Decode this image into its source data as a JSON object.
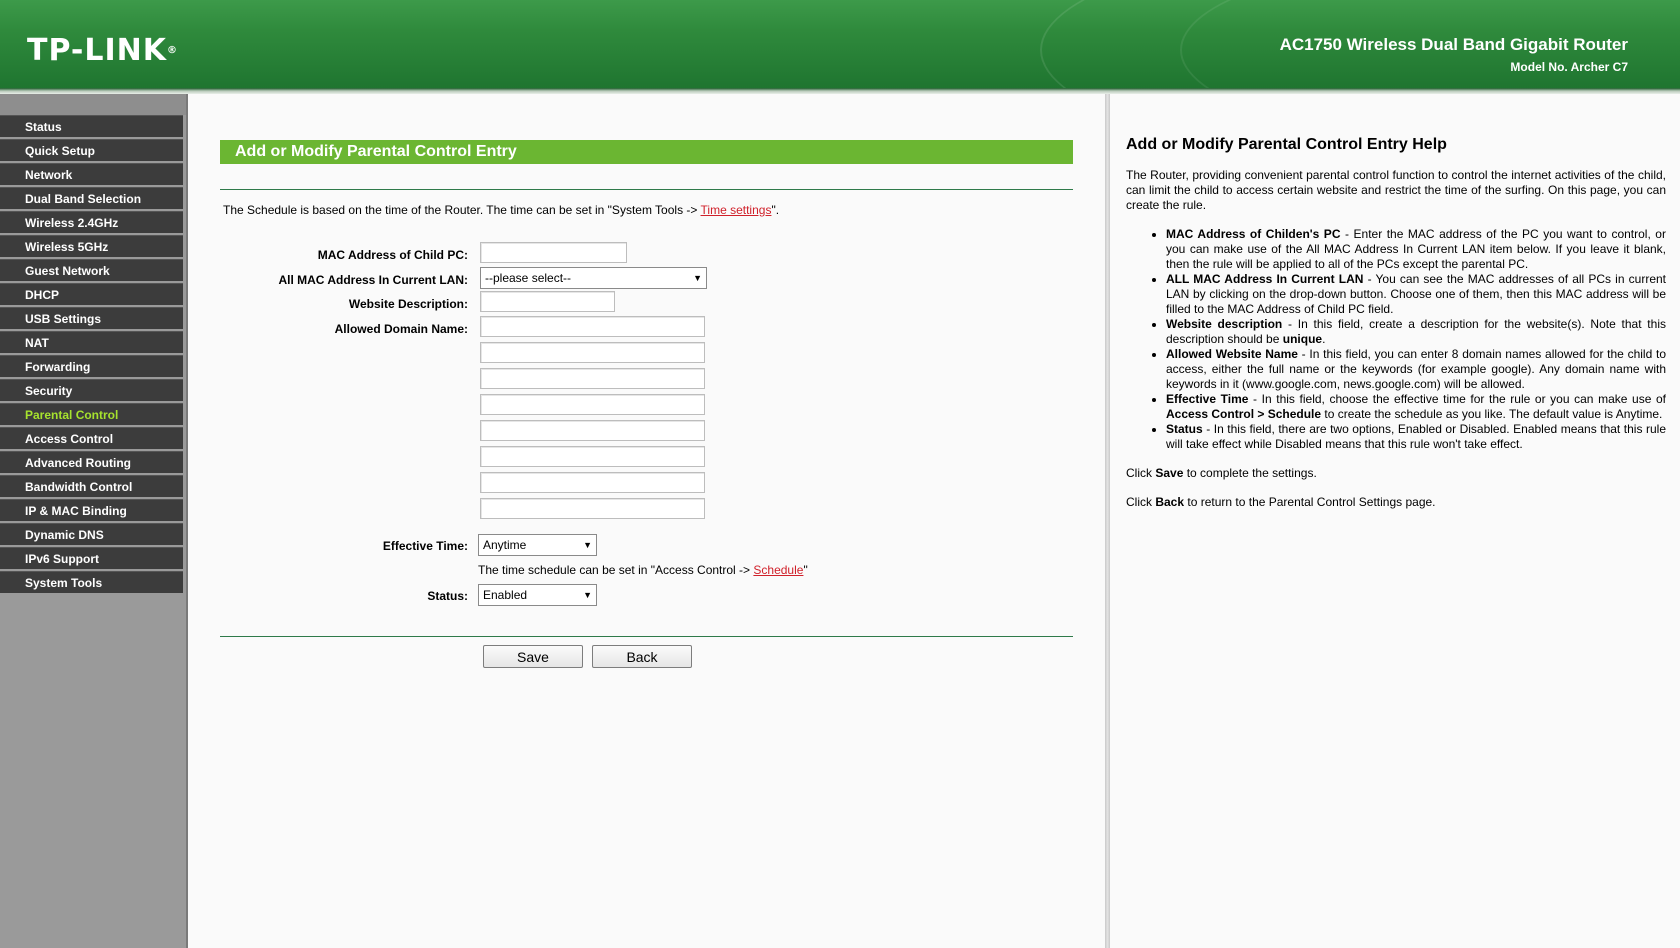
{
  "header": {
    "logo": "TP-LINK",
    "logo_mark": "®",
    "product_name": "AC1750 Wireless Dual Band Gigabit Router",
    "model": "Model No. Archer C7"
  },
  "sidebar": {
    "items": [
      {
        "label": "Status"
      },
      {
        "label": "Quick Setup"
      },
      {
        "label": "Network"
      },
      {
        "label": "Dual Band Selection"
      },
      {
        "label": "Wireless 2.4GHz"
      },
      {
        "label": "Wireless 5GHz"
      },
      {
        "label": "Guest Network"
      },
      {
        "label": "DHCP"
      },
      {
        "label": "USB Settings"
      },
      {
        "label": "NAT"
      },
      {
        "label": "Forwarding"
      },
      {
        "label": "Security"
      },
      {
        "label": "Parental Control"
      },
      {
        "label": "Access Control"
      },
      {
        "label": "Advanced Routing"
      },
      {
        "label": "Bandwidth Control"
      },
      {
        "label": "IP & MAC Binding"
      },
      {
        "label": "Dynamic DNS"
      },
      {
        "label": "IPv6 Support"
      },
      {
        "label": "System Tools"
      }
    ],
    "active_index": 12
  },
  "main": {
    "title": "Add or Modify Parental Control Entry",
    "schedule_note_pre": "The Schedule is based on the time of the Router. The time can be set in \"System Tools -> ",
    "schedule_note_link": "Time settings",
    "schedule_note_post": "\".",
    "fields": {
      "mac_label": "MAC Address of Child PC:",
      "mac_value": "",
      "all_mac_label": "All MAC Address In Current LAN:",
      "all_mac_selected": "--please select--",
      "website_desc_label": "Website Description:",
      "website_desc_value": "",
      "domain_label": "Allowed Domain Name:",
      "domains": [
        "",
        "",
        "",
        "",
        "",
        "",
        "",
        ""
      ],
      "effective_label": "Effective Time:",
      "effective_selected": "Anytime",
      "effective_note_pre": "The time schedule can be set in \"Access Control -> ",
      "effective_note_link": "Schedule",
      "effective_note_post": "\"",
      "status_label": "Status:",
      "status_selected": "Enabled"
    },
    "buttons": {
      "save": "Save",
      "back": "Back"
    }
  },
  "help": {
    "title": "Add or Modify Parental Control Entry Help",
    "intro": "The Router, providing convenient parental control function to control the internet activities of the child, can limit the child to access certain website and restrict the time of the surfing. On this page, you can create the rule.",
    "items": [
      {
        "term": "MAC Address of Childen's PC",
        "text": " - Enter the MAC address of the PC you want to control, or you can make use of the All MAC Address In Current LAN item below. If you leave it blank, then the rule will be applied to all of the PCs except the parental PC."
      },
      {
        "term": "ALL MAC Address In Current LAN",
        "text": " - You can see the MAC addresses of all PCs in current LAN by clicking on the drop-down button. Choose one of them, then this MAC address will be filled to the MAC Address of Child PC field."
      },
      {
        "term": "Website description",
        "text": " - In this field, create a description for the website(s). Note that this description should be ",
        "strong2": "unique",
        "text2": "."
      },
      {
        "term": "Allowed Website Name",
        "text": " - In this field, you can enter 8 domain names allowed for the child to access, either the full name or the keywords (for example google). Any domain name with keywords in it (www.google.com, news.google.com) will be allowed."
      },
      {
        "term": "Effective Time",
        "text": " - In this field, choose the effective time for the rule or you can make use of ",
        "strong2": "Access Control > Schedule",
        "text2": " to create the schedule as you like. The default value is Anytime."
      },
      {
        "term": "Status",
        "text": " - In this field, there are two options, Enabled or Disabled. Enabled means that this rule will take effect while Disabled means that this rule won't take effect."
      }
    ],
    "save_pre": "Click ",
    "save_strong": "Save",
    "save_post": " to complete the settings.",
    "back_pre": "Click ",
    "back_strong": "Back",
    "back_post": " to return to the Parental Control Settings page."
  },
  "colors": {
    "header_green": "#2f8a3c",
    "title_bar_green": "#6bb632",
    "nav_bg": "#3c3c3c",
    "nav_active_text": "#a6e22e",
    "link_red": "#d0202a"
  }
}
